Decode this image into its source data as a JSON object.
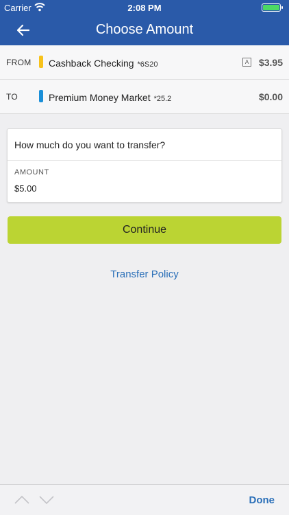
{
  "status_bar": {
    "carrier": "Carrier",
    "time": "2:08 PM"
  },
  "nav": {
    "title": "Choose Amount",
    "back_icon": "back-arrow-icon"
  },
  "from_account": {
    "direction": "FROM",
    "name": "Cashback Checking",
    "suffix": "*6S20",
    "badge": "A",
    "balance": "$3.95",
    "tag_color": "#f7c21b"
  },
  "to_account": {
    "direction": "TO",
    "name": "Premium Money Market",
    "suffix": "*25.2",
    "balance": "$0.00",
    "tag_color": "#1a8fd8"
  },
  "amount_card": {
    "question": "How much do you want to transfer?",
    "label": "AMOUNT",
    "value": "$5.00"
  },
  "continue_label": "Continue",
  "policy_label": "Transfer Policy",
  "keyboard_toolbar": {
    "done_label": "Done"
  },
  "colors": {
    "brand": "#2a5aa9",
    "accent": "#bbd433",
    "link": "#2a6fb8"
  }
}
